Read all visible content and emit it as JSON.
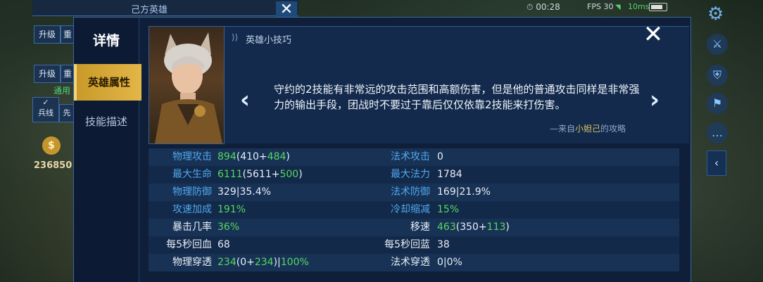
{
  "background": {
    "team_label": "己方英雄",
    "timer": "00:28",
    "fps": "FPS 30",
    "ping": "10ms",
    "left_buttons": [
      "升级",
      "重",
      "升级",
      "重"
    ],
    "general_label": "通用",
    "soldier_label": "兵线",
    "first_label": "先",
    "money": "236850",
    "money_symbol": "$"
  },
  "panel": {
    "title": "详情",
    "tabs": [
      "英雄属性",
      "技能描述"
    ],
    "tips_title": "英雄小技巧",
    "tips_text": "守约的2技能有非常远的攻击范围和高额伤害，但是他的普通攻击同样是非常强力的输出手段，团战时不要过于靠后仅仅依靠2技能来打伤害。",
    "source_prefix": "—来自",
    "source_author": "小妲己",
    "source_suffix": "的攻略",
    "close_glyph": "✕"
  },
  "stats": [
    {
      "left": {
        "label": "物理攻击",
        "blue": true,
        "parts": [
          [
            "894",
            "g"
          ],
          [
            "(410+",
            ""
          ],
          [
            "484",
            "g"
          ],
          [
            ")",
            ""
          ]
        ]
      },
      "right": {
        "label": "法术攻击",
        "blue": true,
        "parts": [
          [
            "0",
            ""
          ]
        ]
      }
    },
    {
      "left": {
        "label": "最大生命",
        "blue": true,
        "parts": [
          [
            "6111",
            "g"
          ],
          [
            "(5611+",
            ""
          ],
          [
            "500",
            "g"
          ],
          [
            ")",
            ""
          ]
        ]
      },
      "right": {
        "label": "最大法力",
        "blue": true,
        "parts": [
          [
            "1784",
            ""
          ]
        ]
      }
    },
    {
      "left": {
        "label": "物理防御",
        "blue": true,
        "parts": [
          [
            "329|35.4%",
            ""
          ]
        ]
      },
      "right": {
        "label": "法术防御",
        "blue": true,
        "parts": [
          [
            "169|21.9%",
            ""
          ]
        ]
      }
    },
    {
      "left": {
        "label": "攻速加成",
        "blue": true,
        "parts": [
          [
            "191%",
            "g"
          ]
        ]
      },
      "right": {
        "label": "冷却缩减",
        "blue": true,
        "parts": [
          [
            "15%",
            "g"
          ]
        ]
      }
    },
    {
      "left": {
        "label": "暴击几率",
        "blue": false,
        "parts": [
          [
            "36%",
            "g"
          ]
        ]
      },
      "right": {
        "label": "移速",
        "blue": false,
        "parts": [
          [
            "463",
            "g"
          ],
          [
            "(350+",
            ""
          ],
          [
            "113",
            "g"
          ],
          [
            ")",
            ""
          ]
        ]
      }
    },
    {
      "left": {
        "label": "每5秒回血",
        "blue": false,
        "parts": [
          [
            "68",
            ""
          ]
        ]
      },
      "right": {
        "label": "每5秒回蓝",
        "blue": false,
        "parts": [
          [
            "38",
            ""
          ]
        ]
      }
    },
    {
      "left": {
        "label": "物理穿透",
        "blue": false,
        "parts": [
          [
            "234",
            "g"
          ],
          [
            "(0+",
            ""
          ],
          [
            "234",
            "g"
          ],
          [
            ")|",
            ""
          ],
          [
            "100%",
            "g"
          ]
        ]
      },
      "right": {
        "label": "法术穿透",
        "blue": false,
        "parts": [
          [
            "0|0%",
            ""
          ]
        ]
      }
    }
  ]
}
